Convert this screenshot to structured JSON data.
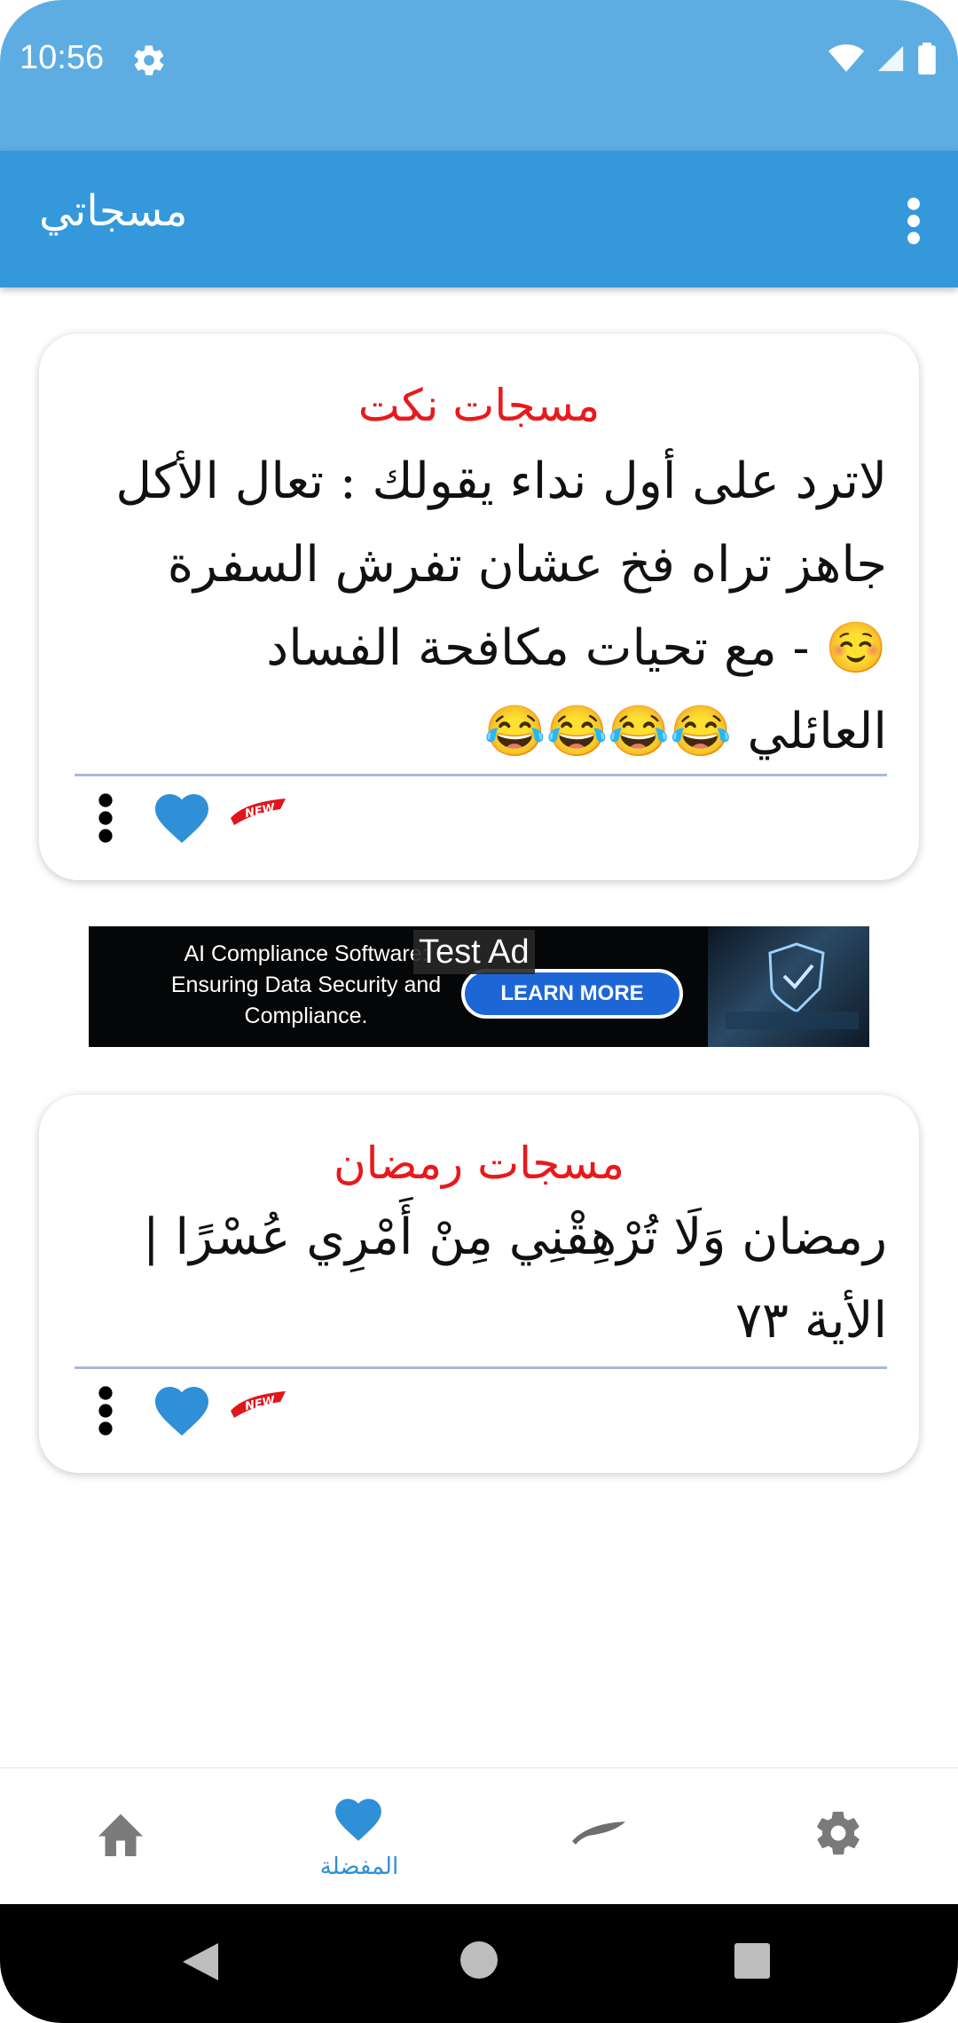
{
  "status_bar": {
    "time": "10:56"
  },
  "app_bar": {
    "title": "مسجاتي"
  },
  "cards": [
    {
      "category": "مسجات نكت",
      "lines": [
        "لاترد على أول نداء يقولك : تعال الأكل",
        "جاهز   تراه فخ عشان تفرش السفرة",
        "☺️  - مع تحيات مكافحة الفساد",
        "العائلي  😂😂😂😂"
      ]
    },
    {
      "category": "مسجات رمضان",
      "lines": [
        "رمضان   وَلَا تُرْهِقْنِي مِنْ أَمْرِي عُسْرًا |",
        "الأية ٧٣"
      ]
    }
  ],
  "ad": {
    "label": "Test Ad",
    "text_lines": [
      "AI Compliance Software:",
      "Ensuring Data Security and",
      "Compliance."
    ],
    "button": "LEARN MORE"
  },
  "bottom_nav": {
    "items": [
      {
        "icon": "home-icon"
      },
      {
        "icon": "heart-icon",
        "label": "المفضلة",
        "active": true
      },
      {
        "icon": "brush-icon"
      },
      {
        "icon": "gear-icon"
      }
    ]
  },
  "colors": {
    "status_bar": "#5dade2",
    "app_bar": "#3498db",
    "category_title": "#e8191c",
    "heart": "#2f8fd7",
    "nav_inactive": "#7a7a7a"
  }
}
